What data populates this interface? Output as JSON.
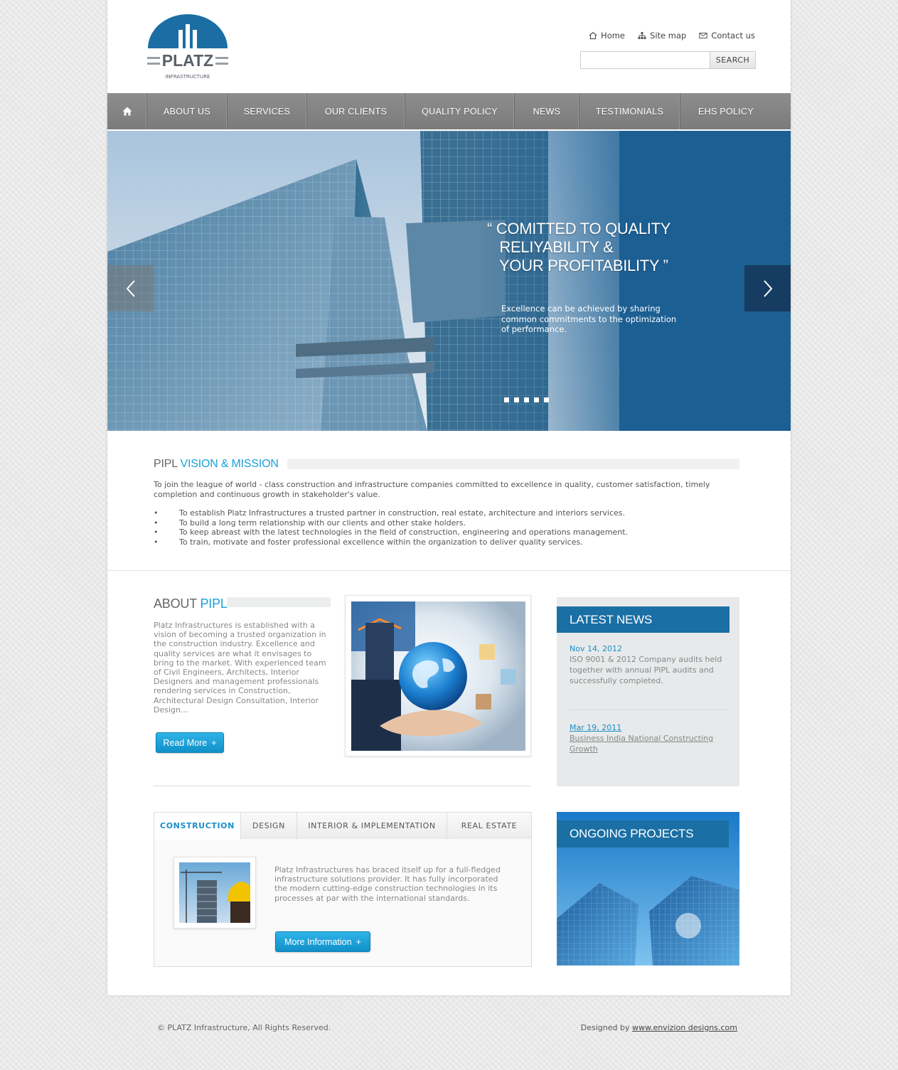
{
  "brand": {
    "name": "PLATZ",
    "tagline": "INFRASTRUCTURE",
    "color": "#1b6ea3"
  },
  "toplinks": [
    {
      "label": "Home",
      "icon": "home-icon"
    },
    {
      "label": "Site map",
      "icon": "sitemap-icon"
    },
    {
      "label": "Contact us",
      "icon": "mail-icon"
    }
  ],
  "search": {
    "value": "",
    "button": "SEARCH"
  },
  "nav": {
    "home_icon": "home-icon",
    "items": [
      "ABOUT US",
      "SERVICES",
      "OUR CLIENTS",
      "QUALITY POLICY",
      "NEWS",
      "TESTIMONIALS",
      "EHS POLICY"
    ]
  },
  "slider": {
    "heading": [
      "“ COMITTED TO QUALITY",
      "   RELIYABILITY &",
      "   YOUR PROFITABILITY ”"
    ],
    "text": "Excellence can be achieved by sharing common commitments to the optimization of performance.",
    "dot_count": 5,
    "accent": "#1c5f92"
  },
  "vision": {
    "title_main": "PIPL ",
    "title_accent": "VISION & MISSION",
    "paragraph": "To join the league of world - class construction and infrastructure companies committed to excellence in quality, customer satisfaction, timely completion and continuous growth in stakeholder's value.",
    "bullet": "•",
    "items": [
      "To establish Platz Infrastructures a trusted partner in construction, real estate, architecture and interiors services.",
      "To build a long term relationship with our clients and other stake holders.",
      "To keep abreast with the latest technologies in the field of construction, engineering and operations management.",
      "To train, motivate and foster professional excellence within the organization to deliver quality services."
    ]
  },
  "about": {
    "title_main": "ABOUT ",
    "title_accent": "PIPL",
    "text": "Platz Infrastructures is established with a vision of becoming a trusted organization in the construction industry. Excellence and quality services are what it envisages to bring to the market. With experienced team of Civil Engineers, Architects, Interior Designers and management professionals rendering services in Construction, Architectural Design Consultation, Interior Design...",
    "button": "Read More",
    "button_icon": "+"
  },
  "news": {
    "title": "LATEST NEWS",
    "items": [
      {
        "date": "Nov 14, 2012",
        "text": "ISO 9001 & 2012 Company audits held together with annual PIPL audits and successfully completed."
      },
      {
        "date": "Mar 19, 2011",
        "text": "Business India National Constructing Growth"
      }
    ]
  },
  "tabs": {
    "items": [
      "CONSTRUCTION",
      "DESIGN",
      "INTERIOR & IMPLEMENTATION",
      "REAL ESTATE"
    ],
    "active": 0,
    "text": "Platz Infrastructures has braced itself up for a full-fledged infrastructure solutions provider. It has fully incorporated the modern cutting-edge construction technologies in its processes at par with the international standards.",
    "button": "More Information",
    "button_icon": "+"
  },
  "ongoing": {
    "title": "ONGOING PROJECTS"
  },
  "footer": {
    "copyright": "© PLATZ Infrastructure, All Rights Reserved.",
    "designed_by": "Designed by ",
    "designer_link": "www.envizion designs.com"
  }
}
